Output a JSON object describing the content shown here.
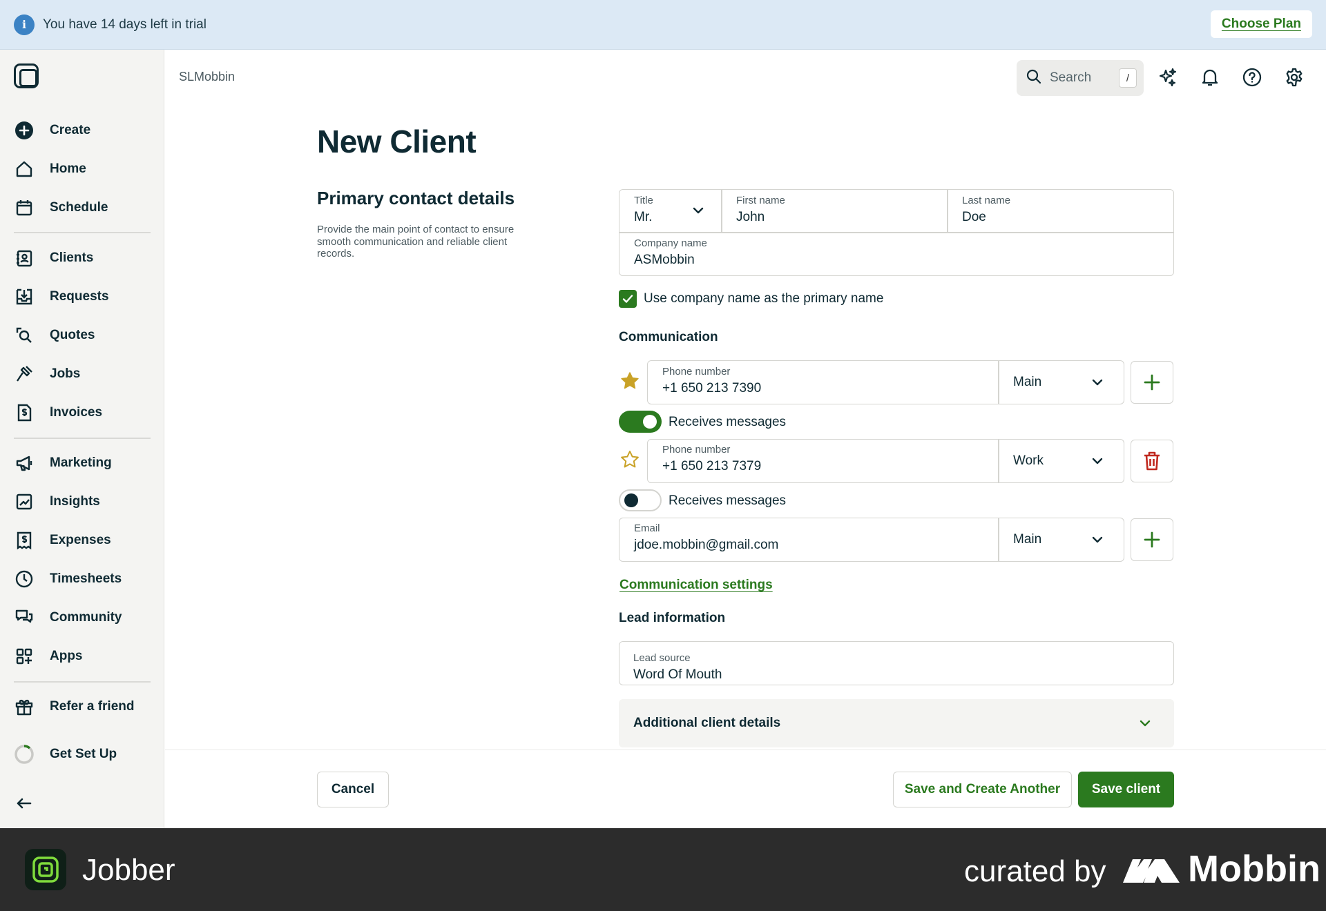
{
  "banner": {
    "message": "You have 14 days left in trial",
    "cta": "Choose Plan"
  },
  "sidebar": {
    "items": [
      {
        "label": "Create",
        "icon": "plus-circle-icon"
      },
      {
        "label": "Home",
        "icon": "home-icon"
      },
      {
        "label": "Schedule",
        "icon": "calendar-icon"
      },
      {
        "label": "Clients",
        "icon": "contact-card-icon"
      },
      {
        "label": "Requests",
        "icon": "inbox-download-icon"
      },
      {
        "label": "Quotes",
        "icon": "magnify-doc-icon"
      },
      {
        "label": "Jobs",
        "icon": "hammer-icon"
      },
      {
        "label": "Invoices",
        "icon": "dollar-doc-icon"
      },
      {
        "label": "Marketing",
        "icon": "megaphone-icon"
      },
      {
        "label": "Insights",
        "icon": "chart-icon"
      },
      {
        "label": "Expenses",
        "icon": "receipt-dollar-icon"
      },
      {
        "label": "Timesheets",
        "icon": "clock-icon"
      },
      {
        "label": "Community",
        "icon": "chat-bubbles-icon"
      },
      {
        "label": "Apps",
        "icon": "apps-grid-icon"
      },
      {
        "label": "Refer a friend",
        "icon": "gift-icon"
      },
      {
        "label": "Get Set Up",
        "icon": "progress-ring-icon"
      }
    ]
  },
  "header": {
    "breadcrumb": "SLMobbin",
    "search_label": "Search",
    "search_shortcut": "/"
  },
  "main": {
    "title": "New Client",
    "section_title": "Primary contact details",
    "section_description": "Provide the main point of contact to ensure smooth communication and reliable client records.",
    "fields": {
      "title": {
        "label": "Title",
        "value": "Mr."
      },
      "first_name": {
        "label": "First name",
        "value": "John"
      },
      "last_name": {
        "label": "Last name",
        "value": "Doe"
      },
      "company_name": {
        "label": "Company name",
        "value": "ASMobbin"
      }
    },
    "use_company_name": {
      "label": "Use company name as the primary name",
      "checked": true
    },
    "communication": {
      "heading": "Communication",
      "phones": [
        {
          "label": "Phone number",
          "value": "+1 650 213 7390",
          "type": "Main",
          "primary": true,
          "receives_messages": true,
          "messages_label": "Receives messages"
        },
        {
          "label": "Phone number",
          "value": "+1 650 213 7379",
          "type": "Work",
          "primary": false,
          "receives_messages": false,
          "messages_label": "Receives messages"
        }
      ],
      "email": {
        "label": "Email",
        "value": "jdoe.mobbin@gmail.com",
        "type": "Main"
      },
      "settings_link": "Communication settings"
    },
    "lead": {
      "heading": "Lead information",
      "source_label": "Lead source",
      "source_value": "Word Of Mouth"
    },
    "additional": "Additional client details"
  },
  "actions": {
    "cancel": "Cancel",
    "save_another": "Save and Create Another",
    "save": "Save client"
  },
  "brand": {
    "app_name": "Jobber",
    "curated_by": "curated by",
    "curator": "Mobbin"
  },
  "colors": {
    "accent_green": "#2b7a1f",
    "navy": "#0f2a33",
    "star_gold": "#c9a227",
    "delete_red": "#c0281e",
    "banner_blue": "#dce9f5"
  }
}
